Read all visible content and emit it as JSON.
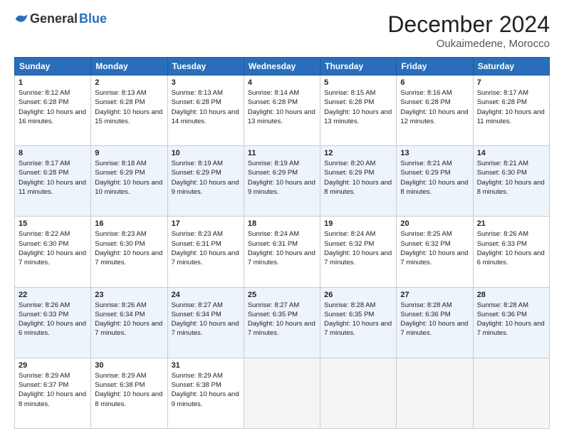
{
  "logo": {
    "general": "General",
    "blue": "Blue"
  },
  "header": {
    "month": "December 2024",
    "location": "Oukaimedene, Morocco"
  },
  "weekdays": [
    "Sunday",
    "Monday",
    "Tuesday",
    "Wednesday",
    "Thursday",
    "Friday",
    "Saturday"
  ],
  "weeks": [
    [
      {
        "day": "1",
        "sunrise": "Sunrise: 8:12 AM",
        "sunset": "Sunset: 6:28 PM",
        "daylight": "Daylight: 10 hours and 16 minutes."
      },
      {
        "day": "2",
        "sunrise": "Sunrise: 8:13 AM",
        "sunset": "Sunset: 6:28 PM",
        "daylight": "Daylight: 10 hours and 15 minutes."
      },
      {
        "day": "3",
        "sunrise": "Sunrise: 8:13 AM",
        "sunset": "Sunset: 6:28 PM",
        "daylight": "Daylight: 10 hours and 14 minutes."
      },
      {
        "day": "4",
        "sunrise": "Sunrise: 8:14 AM",
        "sunset": "Sunset: 6:28 PM",
        "daylight": "Daylight: 10 hours and 13 minutes."
      },
      {
        "day": "5",
        "sunrise": "Sunrise: 8:15 AM",
        "sunset": "Sunset: 6:28 PM",
        "daylight": "Daylight: 10 hours and 13 minutes."
      },
      {
        "day": "6",
        "sunrise": "Sunrise: 8:16 AM",
        "sunset": "Sunset: 6:28 PM",
        "daylight": "Daylight: 10 hours and 12 minutes."
      },
      {
        "day": "7",
        "sunrise": "Sunrise: 8:17 AM",
        "sunset": "Sunset: 6:28 PM",
        "daylight": "Daylight: 10 hours and 11 minutes."
      }
    ],
    [
      {
        "day": "8",
        "sunrise": "Sunrise: 8:17 AM",
        "sunset": "Sunset: 6:28 PM",
        "daylight": "Daylight: 10 hours and 11 minutes."
      },
      {
        "day": "9",
        "sunrise": "Sunrise: 8:18 AM",
        "sunset": "Sunset: 6:29 PM",
        "daylight": "Daylight: 10 hours and 10 minutes."
      },
      {
        "day": "10",
        "sunrise": "Sunrise: 8:19 AM",
        "sunset": "Sunset: 6:29 PM",
        "daylight": "Daylight: 10 hours and 9 minutes."
      },
      {
        "day": "11",
        "sunrise": "Sunrise: 8:19 AM",
        "sunset": "Sunset: 6:29 PM",
        "daylight": "Daylight: 10 hours and 9 minutes."
      },
      {
        "day": "12",
        "sunrise": "Sunrise: 8:20 AM",
        "sunset": "Sunset: 6:29 PM",
        "daylight": "Daylight: 10 hours and 8 minutes."
      },
      {
        "day": "13",
        "sunrise": "Sunrise: 8:21 AM",
        "sunset": "Sunset: 6:29 PM",
        "daylight": "Daylight: 10 hours and 8 minutes."
      },
      {
        "day": "14",
        "sunrise": "Sunrise: 8:21 AM",
        "sunset": "Sunset: 6:30 PM",
        "daylight": "Daylight: 10 hours and 8 minutes."
      }
    ],
    [
      {
        "day": "15",
        "sunrise": "Sunrise: 8:22 AM",
        "sunset": "Sunset: 6:30 PM",
        "daylight": "Daylight: 10 hours and 7 minutes."
      },
      {
        "day": "16",
        "sunrise": "Sunrise: 8:23 AM",
        "sunset": "Sunset: 6:30 PM",
        "daylight": "Daylight: 10 hours and 7 minutes."
      },
      {
        "day": "17",
        "sunrise": "Sunrise: 8:23 AM",
        "sunset": "Sunset: 6:31 PM",
        "daylight": "Daylight: 10 hours and 7 minutes."
      },
      {
        "day": "18",
        "sunrise": "Sunrise: 8:24 AM",
        "sunset": "Sunset: 6:31 PM",
        "daylight": "Daylight: 10 hours and 7 minutes."
      },
      {
        "day": "19",
        "sunrise": "Sunrise: 8:24 AM",
        "sunset": "Sunset: 6:32 PM",
        "daylight": "Daylight: 10 hours and 7 minutes."
      },
      {
        "day": "20",
        "sunrise": "Sunrise: 8:25 AM",
        "sunset": "Sunset: 6:32 PM",
        "daylight": "Daylight: 10 hours and 7 minutes."
      },
      {
        "day": "21",
        "sunrise": "Sunrise: 8:26 AM",
        "sunset": "Sunset: 6:33 PM",
        "daylight": "Daylight: 10 hours and 6 minutes."
      }
    ],
    [
      {
        "day": "22",
        "sunrise": "Sunrise: 8:26 AM",
        "sunset": "Sunset: 6:33 PM",
        "daylight": "Daylight: 10 hours and 6 minutes."
      },
      {
        "day": "23",
        "sunrise": "Sunrise: 8:26 AM",
        "sunset": "Sunset: 6:34 PM",
        "daylight": "Daylight: 10 hours and 7 minutes."
      },
      {
        "day": "24",
        "sunrise": "Sunrise: 8:27 AM",
        "sunset": "Sunset: 6:34 PM",
        "daylight": "Daylight: 10 hours and 7 minutes."
      },
      {
        "day": "25",
        "sunrise": "Sunrise: 8:27 AM",
        "sunset": "Sunset: 6:35 PM",
        "daylight": "Daylight: 10 hours and 7 minutes."
      },
      {
        "day": "26",
        "sunrise": "Sunrise: 8:28 AM",
        "sunset": "Sunset: 6:35 PM",
        "daylight": "Daylight: 10 hours and 7 minutes."
      },
      {
        "day": "27",
        "sunrise": "Sunrise: 8:28 AM",
        "sunset": "Sunset: 6:36 PM",
        "daylight": "Daylight: 10 hours and 7 minutes."
      },
      {
        "day": "28",
        "sunrise": "Sunrise: 8:28 AM",
        "sunset": "Sunset: 6:36 PM",
        "daylight": "Daylight: 10 hours and 7 minutes."
      }
    ],
    [
      {
        "day": "29",
        "sunrise": "Sunrise: 8:29 AM",
        "sunset": "Sunset: 6:37 PM",
        "daylight": "Daylight: 10 hours and 8 minutes."
      },
      {
        "day": "30",
        "sunrise": "Sunrise: 8:29 AM",
        "sunset": "Sunset: 6:38 PM",
        "daylight": "Daylight: 10 hours and 8 minutes."
      },
      {
        "day": "31",
        "sunrise": "Sunrise: 8:29 AM",
        "sunset": "Sunset: 6:38 PM",
        "daylight": "Daylight: 10 hours and 9 minutes."
      },
      null,
      null,
      null,
      null
    ]
  ]
}
